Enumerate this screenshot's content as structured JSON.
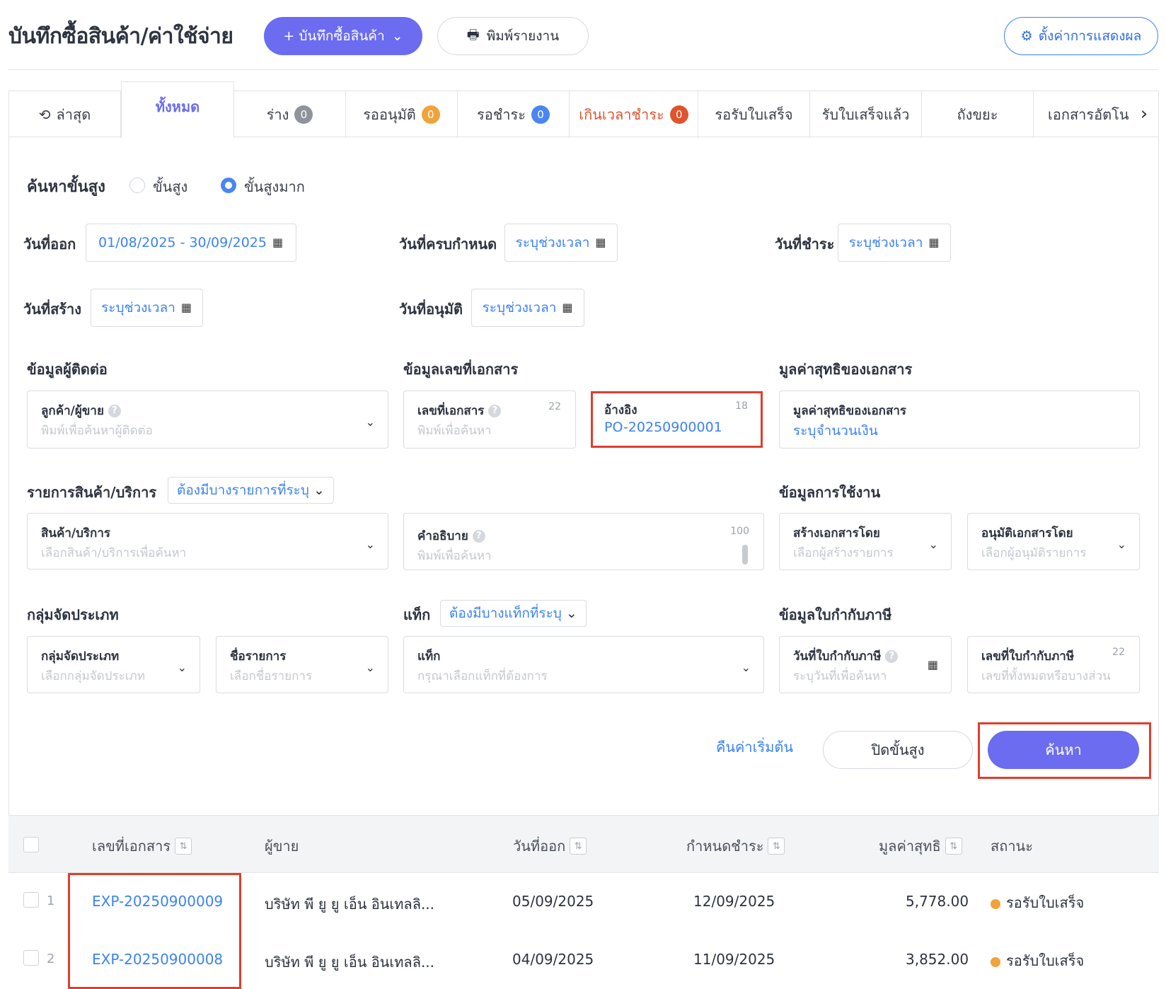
{
  "header": {
    "title": "บันทึกซื้อสินค้า/ค่าใช้จ่าย",
    "create_button": "+ บันทึกซื้อสินค้า",
    "print_button": "พิมพ์รายงาน",
    "settings_button": "ตั้งค่าการแสดงผล"
  },
  "tabs": [
    {
      "label": "ล่าสุด"
    },
    {
      "label": "ทั้งหมด"
    },
    {
      "label": "ร่าง",
      "badge": "0",
      "badge_color": "#8e939c"
    },
    {
      "label": "รออนุมัติ",
      "badge": "0",
      "badge_color": "#f0a33a"
    },
    {
      "label": "รอชำระ",
      "badge": "0",
      "badge_color": "#4a86f2"
    },
    {
      "label": "เกินเวลาชำระ",
      "badge": "0",
      "badge_color": "#e0532d"
    },
    {
      "label": "รอรับใบเสร็จ"
    },
    {
      "label": "รับใบเสร็จแล้ว"
    },
    {
      "label": "ถังขยะ"
    },
    {
      "label": "เอกสารอัตโน"
    }
  ],
  "search": {
    "title": "ค้นหาขั้นสูง",
    "mode_advanced": "ขั้นสูง",
    "mode_very_advanced": "ขั้นสูงมาก",
    "issue_date_label": "วันที่ออก",
    "issue_date_value": "01/08/2025 - 30/09/2025",
    "due_date_label": "วันที่ครบกำหนด",
    "due_date_value": "ระบุช่วงเวลา",
    "paid_date_label": "วันที่ชำระ",
    "paid_date_value": "ระบุช่วงเวลา",
    "created_date_label": "วันที่สร้าง",
    "created_date_value": "ระบุช่วงเวลา",
    "approved_date_label": "วันที่อนุมัติ",
    "approved_date_value": "ระบุช่วงเวลา",
    "contact_section": "ข้อมูลผู้ติดต่อ",
    "contact_label": "ลูกค้า/ผู้ขาย",
    "contact_placeholder": "พิมพ์เพื่อค้นหาผู้ติดต่อ",
    "docno_section": "ข้อมูลเลขที่เอกสาร",
    "docno_label": "เลขที่เอกสาร",
    "docno_count": "22",
    "docno_placeholder": "พิมพ์เพื่อค้นหา",
    "ref_label": "อ้างอิง",
    "ref_count": "18",
    "ref_value": "PO-20250900001",
    "net_section": "มูลค่าสุทธิของเอกสาร",
    "net_label": "มูลค่าสุทธิของเอกสาร",
    "net_value": "ระบุจำนวนเงิน",
    "product_section": "รายการสินค้า/บริการ",
    "product_filter": "ต้องมีบางรายการที่ระบุ",
    "product_label": "สินค้า/บริการ",
    "product_placeholder": "เลือกสินค้า/บริการเพื่อค้นหา",
    "desc_label": "คำอธิบาย",
    "desc_count": "100",
    "desc_placeholder": "พิมพ์เพื่อค้นหา",
    "usage_section": "ข้อมูลการใช้งาน",
    "created_by_label": "สร้างเอกสารโดย",
    "created_by_placeholder": "เลือกผู้สร้างรายการ",
    "approved_by_label": "อนุมัติเอกสารโดย",
    "approved_by_placeholder": "เลือกผู้อนุมัติรายการ",
    "category_section": "กลุ่มจัดประเภท",
    "category_label": "กลุ่มจัดประเภท",
    "category_placeholder": "เลือกกลุ่มจัดประเภท",
    "item_name_label": "ชื่อรายการ",
    "item_name_placeholder": "เลือกชื่อรายการ",
    "tag_section": "แท็ก",
    "tag_filter": "ต้องมีบางแท็กที่ระบุ",
    "tag_label": "แท็ก",
    "tag_placeholder": "กรุณาเลือกแท็กที่ต้องการ",
    "tax_section": "ข้อมูลใบกำกับภาษี",
    "tax_date_label": "วันที่ใบกำกับภาษี",
    "tax_date_placeholder": "ระบุวันที่เพื่อค้นหา",
    "tax_no_label": "เลขที่ใบกำกับภาษี",
    "tax_no_count": "22",
    "tax_no_placeholder": "เลขที่ทั้งหมดหรือบางส่วน",
    "reset_link": "คืนค่าเริ่มต้น",
    "close_button": "ปิดขั้นสูง",
    "search_button": "ค้นหา"
  },
  "table": {
    "columns": [
      "เลขที่เอกสาร",
      "ผู้ขาย",
      "วันที่ออก",
      "กำหนดชำระ",
      "มูลค่าสุทธิ",
      "สถานะ"
    ],
    "rows": [
      {
        "num": "1",
        "doc": "EXP-20250900009",
        "vendor": "บริษัท พี ยู ยู เอ็น อินเทลลิ...",
        "issue": "05/09/2025",
        "due": "12/09/2025",
        "net": "5,778.00",
        "status": "รอรับใบเสร็จ"
      },
      {
        "num": "2",
        "doc": "EXP-20250900008",
        "vendor": "บริษัท พี ยู ยู เอ็น อินเทลลิ...",
        "issue": "04/09/2025",
        "due": "11/09/2025",
        "net": "3,852.00",
        "status": "รอรับใบเสร็จ"
      }
    ]
  },
  "colors": {
    "primary": "#6b6cf0",
    "link": "#3b82f6",
    "highlight": "#e03e2d",
    "status_pending": "#f0a33a"
  }
}
